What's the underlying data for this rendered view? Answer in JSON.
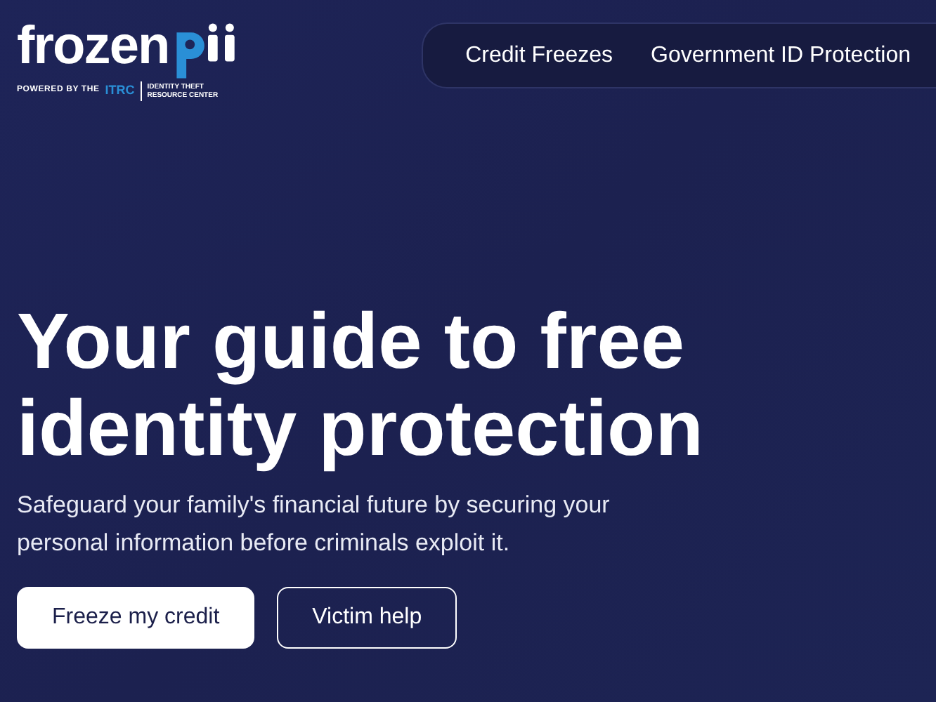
{
  "logo": {
    "wordmark": "frozen",
    "powered_by": "POWERED BY THE",
    "partner": "ITRC",
    "partner_name": "IDENTITY THEFT RESOURCE CENTER"
  },
  "nav": {
    "items": [
      "Credit Freezes",
      "Government ID Protection"
    ]
  },
  "hero": {
    "title": "Your guide to free identity protection",
    "subtitle": "Safeguard your family's financial future by securing your personal information before criminals exploit it.",
    "buttons": [
      {
        "label": "Freeze my credit",
        "kind": "primary"
      },
      {
        "label": "Victim help",
        "kind": "outline"
      }
    ]
  }
}
